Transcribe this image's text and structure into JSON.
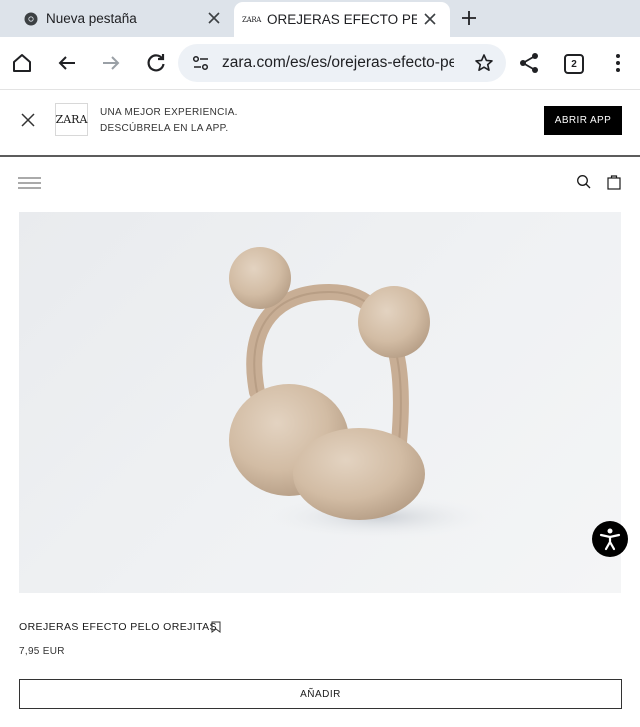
{
  "browser": {
    "tabs": [
      {
        "title": "Nueva pestaña",
        "active": false,
        "favicon": "chrome-icon"
      },
      {
        "title": "OREJERAS EFECTO PELO OREJITAS",
        "active": true,
        "favicon": "zara-favicon",
        "favicon_text": "ZARA"
      }
    ],
    "tab_count": "2",
    "url": "zara.com/es/es/orejeras-efecto-pelo-orejitas",
    "icons": [
      "home-icon",
      "back-icon",
      "forward-icon",
      "reload-icon",
      "site-settings-icon",
      "star-icon",
      "share-icon",
      "tab-switcher-icon",
      "more-menu-icon",
      "new-tab-icon"
    ]
  },
  "banner": {
    "logo": "ZARA",
    "line1": "UNA MEJOR EXPERIENCIA.",
    "line2": "DESCÚBRELA EN LA APP.",
    "button": "ABRIR APP"
  },
  "product": {
    "name": "OREJERAS EFECTO PELO OREJITAS",
    "price": "7,95 EUR",
    "add_button": "AÑADIR",
    "image": "beige-fur-earmuffs-with-bear-ears",
    "colors": {
      "fur": "#d4bfa7",
      "background": "#edeff1"
    }
  }
}
